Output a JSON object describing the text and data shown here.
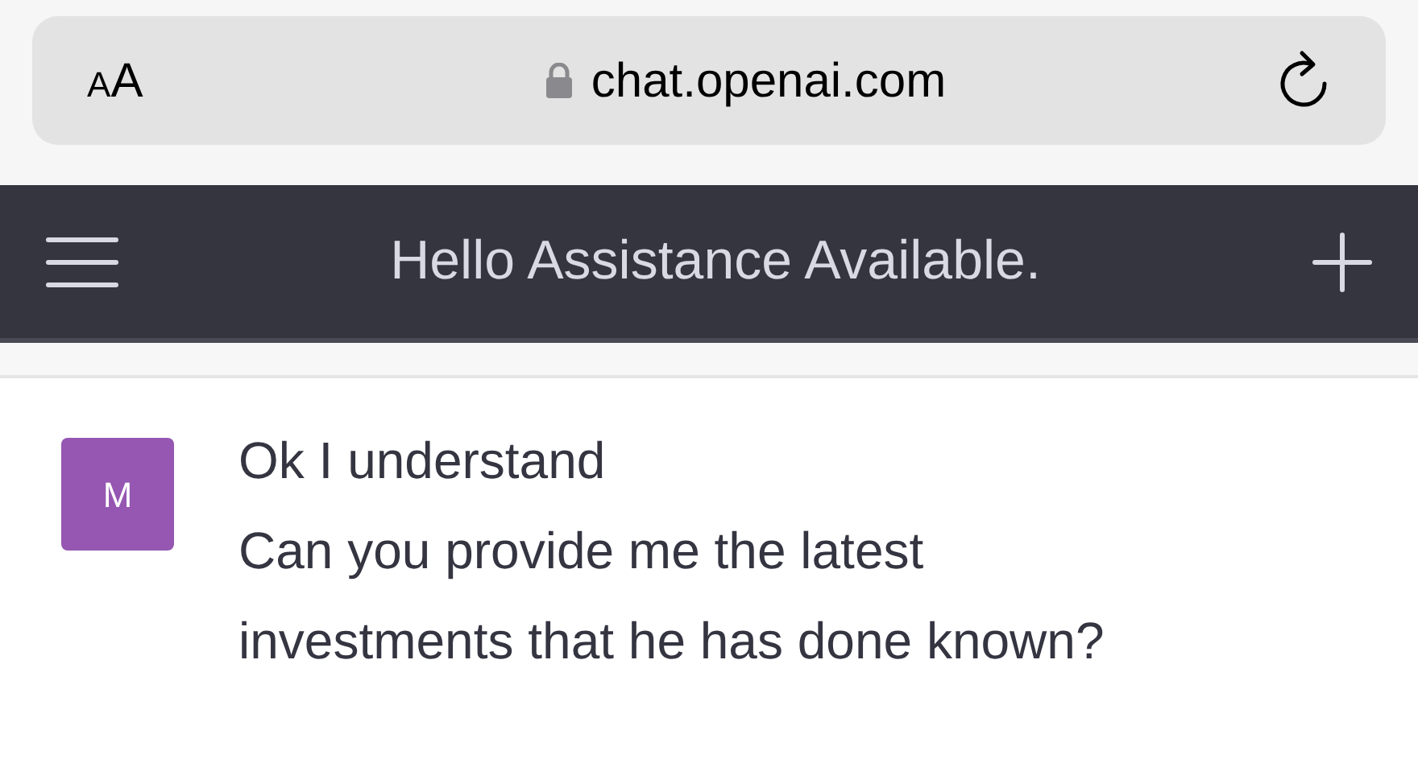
{
  "browser": {
    "text_size_button": "AA",
    "url": "chat.openai.com"
  },
  "header": {
    "title": "Hello Assistance Available."
  },
  "messages": [
    {
      "avatar": "M",
      "color": "#9557b2",
      "lines": [
        "Ok I understand",
        "Can you provide me the latest investments that he has done known?"
      ]
    }
  ]
}
